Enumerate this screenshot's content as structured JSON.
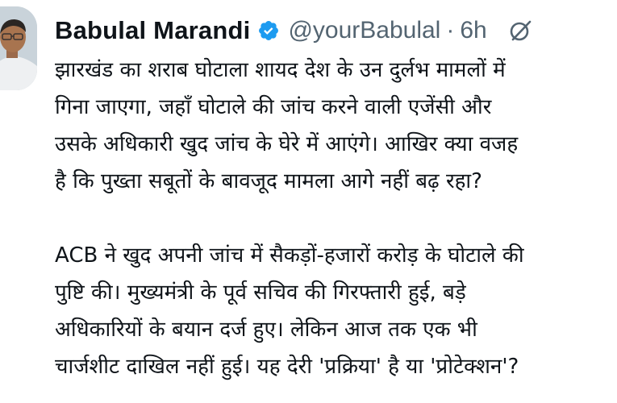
{
  "tweet": {
    "author": {
      "name": "Babulal Marandi",
      "handle": "@yourBabulal",
      "separator": "·",
      "time": "6h",
      "verified": true
    },
    "icons": {
      "verified": "verified-badge-icon",
      "grok": "grok-icon",
      "avatar": "profile-photo"
    },
    "colors": {
      "verified_badge": "#1d9bf0",
      "handle": "#536471",
      "text": "#0f1419"
    },
    "paragraph1": [
      "झारखंड का शराब घोटाला शायद देश के उन दुर्लभ मामलों में",
      "गिना जाएगा, जहाँ घोटाले की जांच करने वाली एजेंसी और",
      "उसके अधिकारी खुद जांच के घेरे में आएंगे। आखिर क्या वजह",
      "है कि पुख्ता सबूतों के बावजूद मामला आगे नहीं बढ़ रहा?"
    ],
    "paragraph2": [
      "ACB ने खुद अपनी जांच में सैकड़ों-हजारों करोड़ के घोटाले की",
      "पुष्टि की। मुख्यमंत्री के पूर्व सचिव की गिरफ्तारी हुई, बड़े",
      "अधिकारियों के बयान दर्ज हुए। लेकिन आज तक एक भी",
      "चार्जशीट दाखिल नहीं हुई। यह देरी 'प्रक्रिया' है या 'प्रोटेक्शन'?"
    ]
  }
}
